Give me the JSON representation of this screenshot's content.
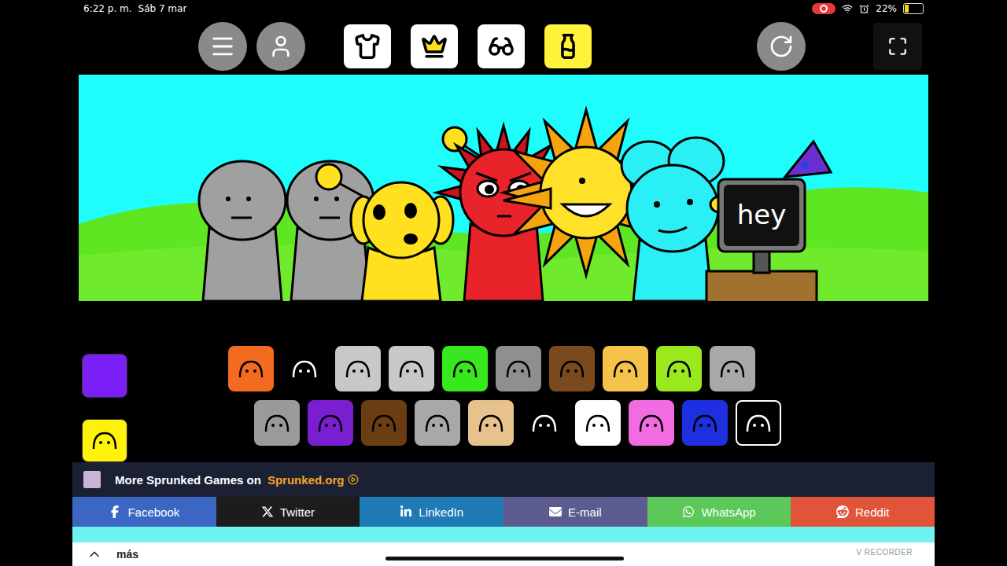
{
  "status_bar": {
    "time": "6:22 p. m.",
    "date": "Sáb 7 mar",
    "recording": true,
    "battery": {
      "reading": "22%",
      "level": 0.22
    }
  },
  "toolbar": {
    "tools": [
      {
        "kind": "shirt",
        "selected": false
      },
      {
        "kind": "crown",
        "selected": false
      },
      {
        "kind": "glasses",
        "selected": false
      },
      {
        "kind": "bottle",
        "selected": true
      }
    ]
  },
  "stage": {
    "characters": [
      {
        "kind": "plain",
        "color": "#a0a0a0"
      },
      {
        "kind": "antenna",
        "color": "#a0a0a0"
      },
      {
        "kind": "dog",
        "color": "#ffe11f"
      },
      {
        "kind": "spiky",
        "color": "#e8242a"
      },
      {
        "kind": "sun",
        "color": "#ffe12a"
      },
      {
        "kind": "bunny",
        "color": "#2af0f5"
      },
      {
        "kind": "tv",
        "color": "#111111",
        "screen": "hey"
      }
    ]
  },
  "swatches": [
    {
      "color": "#7a1ff5"
    },
    {
      "color": "#fff20a"
    }
  ],
  "palette": {
    "rows": [
      [
        {
          "color": "#f26b21",
          "selected": false
        },
        {
          "color": "#000000",
          "selected": false
        },
        {
          "color": "#c8c8c8",
          "selected": false
        },
        {
          "color": "#c8c8c8",
          "selected": false
        },
        {
          "color": "#38e81e",
          "selected": false
        },
        {
          "color": "#8f8f8f",
          "selected": false
        },
        {
          "color": "#7a4a1e",
          "selected": false
        },
        {
          "color": "#f5c24a",
          "selected": false
        },
        {
          "color": "#9ae81e",
          "selected": false
        },
        {
          "color": "#a8a8a8",
          "selected": false
        }
      ],
      [
        {
          "color": "#9a9a9a",
          "selected": false
        },
        {
          "color": "#7a1fd0",
          "selected": false
        },
        {
          "color": "#6b3d12",
          "selected": false
        },
        {
          "color": "#a8a8a8",
          "selected": false
        },
        {
          "color": "#e8c28c",
          "selected": false
        },
        {
          "color": "#000000",
          "selected": false
        },
        {
          "color": "#ffffff",
          "selected": false
        },
        {
          "color": "#f06ce0",
          "selected": false
        },
        {
          "color": "#1e2fe0",
          "selected": false
        },
        {
          "color": "#000000",
          "selected": true
        }
      ]
    ]
  },
  "banner": {
    "text": "More Sprunked Games on",
    "link": "Sprunked.org"
  },
  "share": [
    {
      "kind": "facebook",
      "label": "Facebook",
      "color": "#3b66c4"
    },
    {
      "kind": "twitter",
      "label": "Twitter",
      "color": "#1c1c1c"
    },
    {
      "kind": "linkedin",
      "label": "LinkedIn",
      "color": "#1f7bb5"
    },
    {
      "kind": "email",
      "label": "E-mail",
      "color": "#5b5b8f"
    },
    {
      "kind": "whatsapp",
      "label": "WhatsApp",
      "color": "#5cc85a"
    },
    {
      "kind": "reddit",
      "label": "Reddit",
      "color": "#e0553a"
    }
  ],
  "footer": {
    "label": "más"
  },
  "watermark": "V RECORDER"
}
